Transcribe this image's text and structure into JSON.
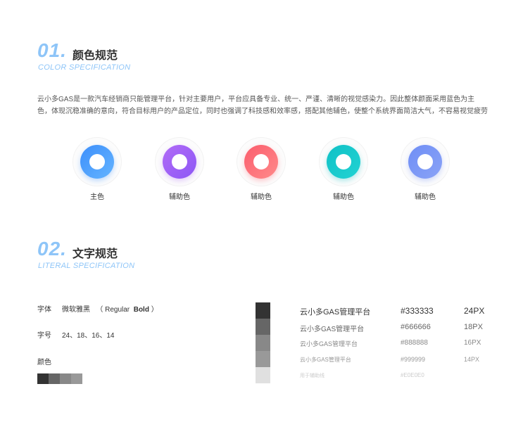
{
  "color_section": {
    "number": "01.",
    "title": "颜色规范",
    "subtitle": "COLOR SPECIFICATION",
    "description": "云小多GAS是一款汽车经销商只能管理平台，针对主要用户，平台应具备专业、统一、严谨、清晰的视觉感染力。因此整体颜面采用蓝色为主色，体现沉稳准确的意向，符合目标用户的产品定位，同时也强调了科技感和效率感，搭配其他辅色，使整个系统界面简洁大气，不容易视觉疲劳",
    "swatches": [
      {
        "label": "主色",
        "from": "#3d8ffb",
        "to": "#64b4ff"
      },
      {
        "label": "辅助色",
        "from": "#b16bf7",
        "to": "#8d57f5"
      },
      {
        "label": "辅助色",
        "from": "#fb5d6d",
        "to": "#ff8a8a"
      },
      {
        "label": "辅助色",
        "from": "#0fc1c6",
        "to": "#22d3d3"
      },
      {
        "label": "辅助色",
        "from": "#6f8ef5",
        "to": "#8aa3f7"
      }
    ]
  },
  "text_section": {
    "number": "02.",
    "title": "文字规范",
    "subtitle": "LITERAL SPECIFICATION",
    "font_label": "字体",
    "font_value": "微软雅黑",
    "font_weights_open": "（ Regular",
    "font_weights_bold": "Bold",
    "font_weights_close": "）",
    "size_label": "字号",
    "size_value": "24、18、16、14",
    "color_label": "颜色",
    "mini_colors": [
      "#333333",
      "#666666",
      "#888888",
      "#999999"
    ],
    "bar_colors": [
      "#333333",
      "#666666",
      "#888888",
      "#999999",
      "#e0e0e0"
    ],
    "styles": [
      {
        "sample": "云小多GAS管理平台",
        "hex": "#333333",
        "size": "24PX",
        "color": "#333333"
      },
      {
        "sample": "云小多GAS管理平台",
        "hex": "#666666",
        "size": "18PX",
        "color": "#666666"
      },
      {
        "sample": "云小多GAS管理平台",
        "hex": "#888888",
        "size": "16PX",
        "color": "#888888"
      },
      {
        "sample": "云小多GAS管理平台",
        "hex": "#999999",
        "size": "14PX",
        "color": "#999999"
      },
      {
        "sample": "用于辅助线",
        "hex": "#E0E0E0",
        "size": "",
        "color": "#cccccc"
      }
    ]
  }
}
